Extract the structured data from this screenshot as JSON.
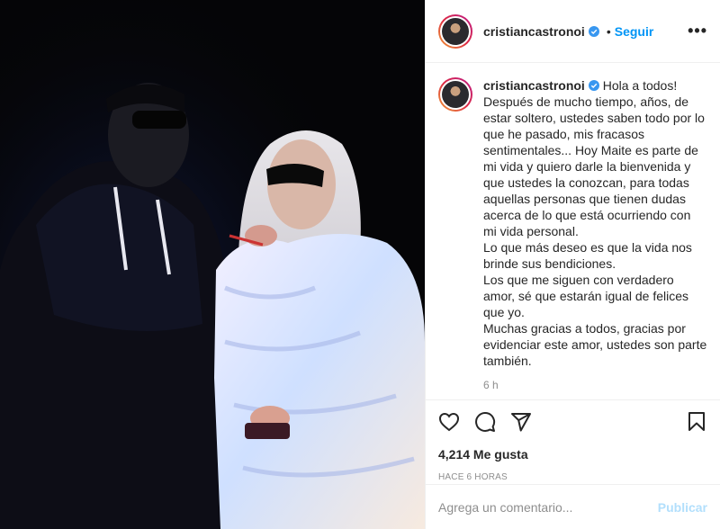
{
  "post": {
    "username": "cristiancastronoi",
    "verified": true,
    "separator": "•",
    "follow_label": "Seguir",
    "more_label": "•••",
    "caption_text": "Hola a todos!\nDespués de mucho tiempo, años, de estar soltero, ustedes saben todo por lo que he pasado, mis fracasos sentimentales... Hoy Maite es parte de mi vida y quiero darle la bienvenida y que ustedes la conozcan, para todas aquellas personas que tienen dudas acerca de lo que está ocurriendo con mi vida personal.\nLo que más deseo es que la vida nos brinde sus bendiciones.\nLos que me siguen con verdadero amor, sé que estarán igual de felices que yo.\nMuchas gracias a todos, gracias por evidenciar este amor, ustedes son parte también.",
    "caption_time": "6 h",
    "likes": "4,214 Me gusta",
    "posted_ago": "HACE 6 HORAS"
  },
  "comment": {
    "placeholder": "Agrega un comentario...",
    "publish_label": "Publicar"
  },
  "icons": {
    "like": "heart-icon",
    "comment": "comment-icon",
    "share": "send-icon",
    "save": "bookmark-icon",
    "verified": "verified-badge-icon"
  },
  "colors": {
    "accent": "#0095f6",
    "publish_disabled": "#b2dffc",
    "muted": "#8e8e8e"
  }
}
